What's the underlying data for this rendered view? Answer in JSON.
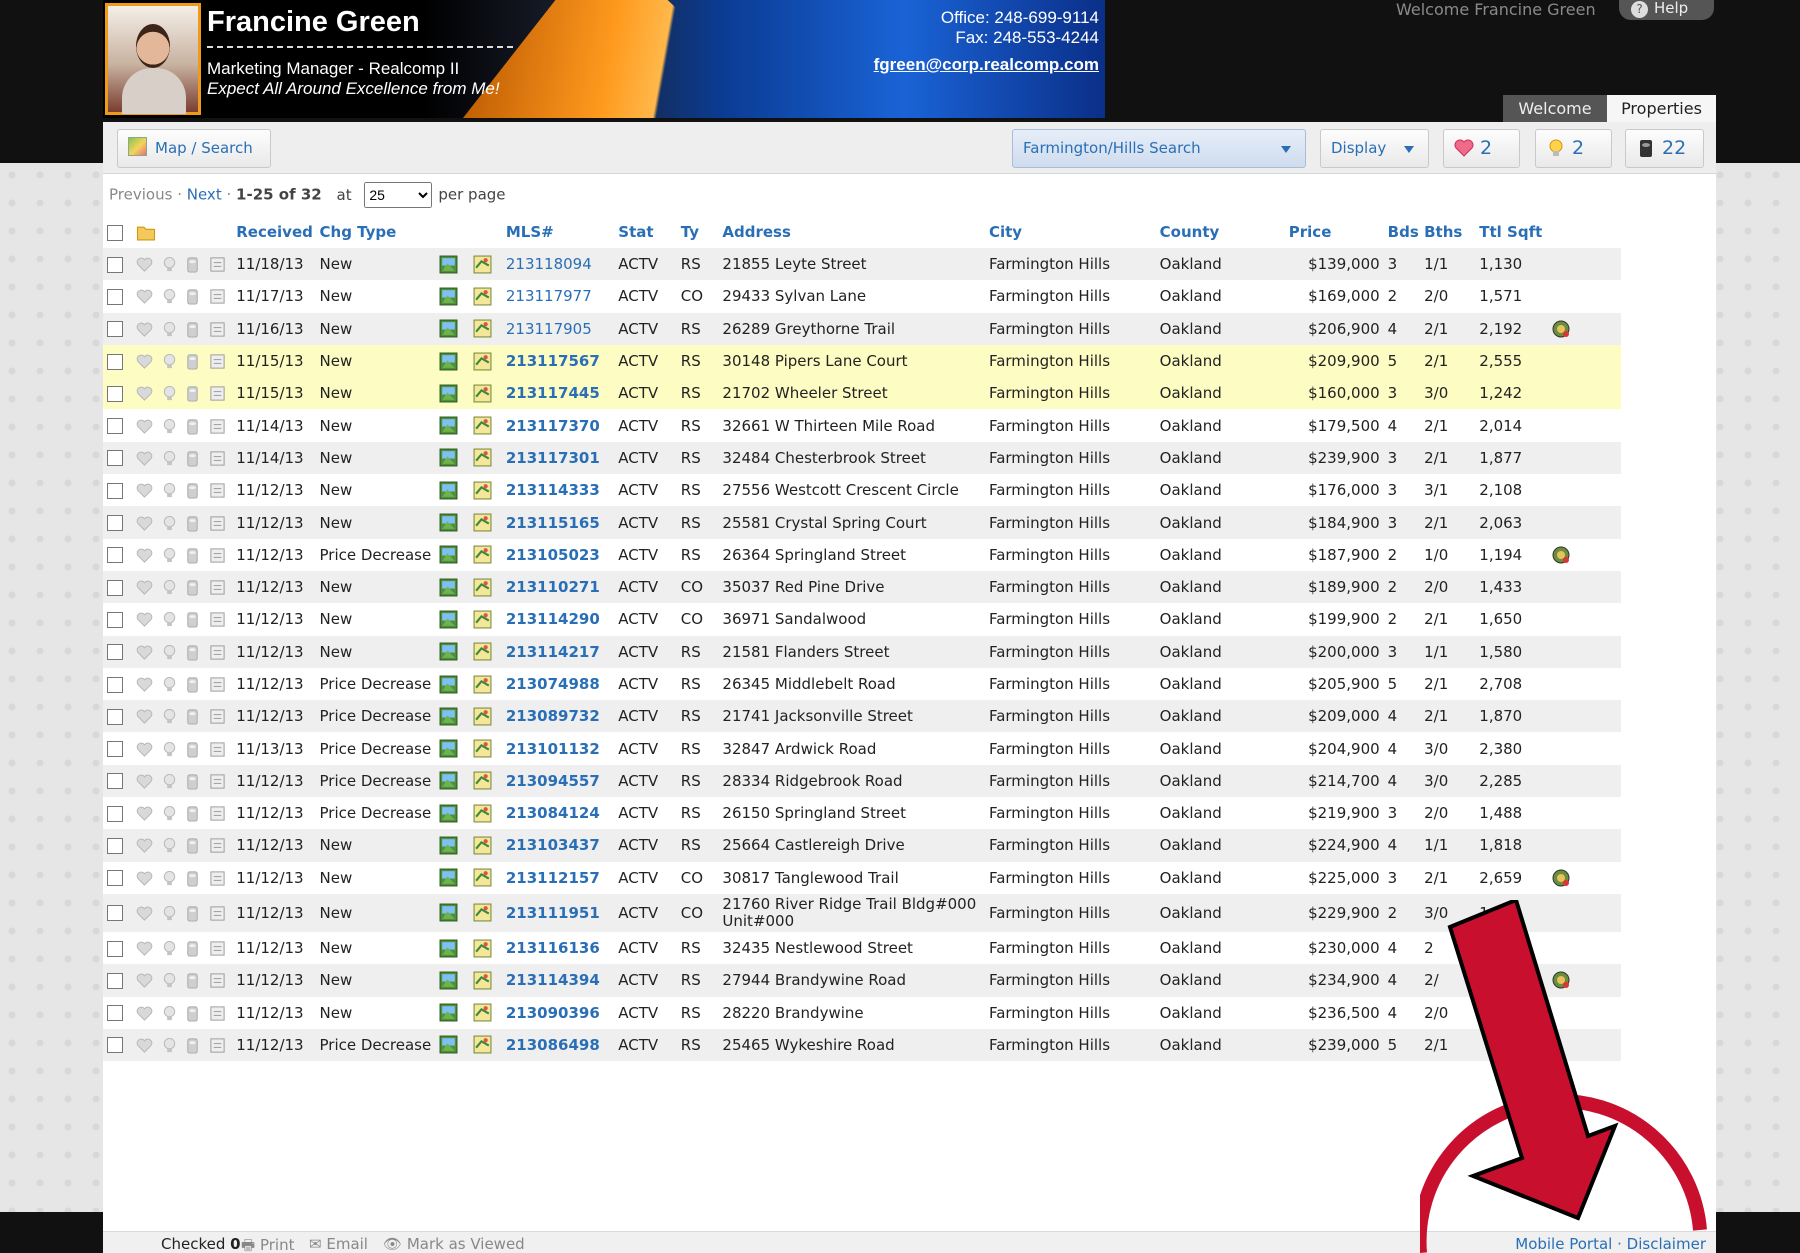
{
  "header": {
    "name": "Francine Green",
    "role": "Marketing Manager - Realcomp II",
    "tagline": "Expect All Around Excellence from Me!",
    "office": "Office: 248-699-9114",
    "fax": "Fax: 248-553-4244",
    "email": "fgreen@corp.realcomp.com",
    "welcome": "Welcome Francine Green",
    "help": "Help",
    "help_icon": "?"
  },
  "tabs": {
    "welcome": "Welcome",
    "properties": "Properties"
  },
  "toolbar": {
    "map_search": "Map / Search",
    "saved_search": "Farmington/Hills Search",
    "display": "Display",
    "favorites_count": "2",
    "possibilities_count": "2",
    "trash_count": "22"
  },
  "pager": {
    "previous": "Previous",
    "sep": "·",
    "next": "Next",
    "range": "1-25 of 32",
    "at": "at",
    "per_page_value": "25",
    "per_page_label": "per page"
  },
  "columns": {
    "received": "Received",
    "chg_type": "Chg Type",
    "mls": "MLS#",
    "stat": "Stat",
    "ty": "Ty",
    "address": "Address",
    "city": "City",
    "county": "County",
    "price": "Price",
    "bds": "Bds",
    "bths": "Bths",
    "sqft": "Ttl Sqft"
  },
  "rows": [
    {
      "date": "11/18/13",
      "chg": "New",
      "mls": "213118094",
      "stat": "ACTV",
      "ty": "RS",
      "address": "21855 Leyte Street",
      "city": "Farmington Hills",
      "county": "Oakland",
      "price": "$139,000",
      "bds": "3",
      "bths": "1/1",
      "sqft": "1,130"
    },
    {
      "date": "11/17/13",
      "chg": "New",
      "mls": "213117977",
      "stat": "ACTV",
      "ty": "CO",
      "address": "29433 Sylvan Lane",
      "city": "Farmington Hills",
      "county": "Oakland",
      "price": "$169,000",
      "bds": "2",
      "bths": "2/0",
      "sqft": "1,571"
    },
    {
      "date": "11/16/13",
      "chg": "New",
      "mls": "213117905",
      "stat": "ACTV",
      "ty": "RS",
      "address": "26289 Greythorne Trail",
      "city": "Farmington Hills",
      "county": "Oakland",
      "price": "$206,900",
      "bds": "4",
      "bths": "2/1",
      "sqft": "2,192"
    },
    {
      "date": "11/15/13",
      "chg": "New",
      "mls": "213117567",
      "stat": "ACTV",
      "ty": "RS",
      "address": "30148 Pipers Lane Court",
      "city": "Farmington Hills",
      "county": "Oakland",
      "price": "$209,900",
      "bds": "5",
      "bths": "2/1",
      "sqft": "2,555"
    },
    {
      "date": "11/15/13",
      "chg": "New",
      "mls": "213117445",
      "stat": "ACTV",
      "ty": "RS",
      "address": "21702 Wheeler Street",
      "city": "Farmington Hills",
      "county": "Oakland",
      "price": "$160,000",
      "bds": "3",
      "bths": "3/0",
      "sqft": "1,242"
    },
    {
      "date": "11/14/13",
      "chg": "New",
      "mls": "213117370",
      "stat": "ACTV",
      "ty": "RS",
      "address": "32661 W Thirteen Mile Road",
      "city": "Farmington Hills",
      "county": "Oakland",
      "price": "$179,500",
      "bds": "4",
      "bths": "2/1",
      "sqft": "2,014"
    },
    {
      "date": "11/14/13",
      "chg": "New",
      "mls": "213117301",
      "stat": "ACTV",
      "ty": "RS",
      "address": "32484 Chesterbrook Street",
      "city": "Farmington Hills",
      "county": "Oakland",
      "price": "$239,900",
      "bds": "3",
      "bths": "2/1",
      "sqft": "1,877"
    },
    {
      "date": "11/12/13",
      "chg": "New",
      "mls": "213114333",
      "stat": "ACTV",
      "ty": "RS",
      "address": "27556 Westcott Crescent Circle",
      "city": "Farmington Hills",
      "county": "Oakland",
      "price": "$176,000",
      "bds": "3",
      "bths": "3/1",
      "sqft": "2,108"
    },
    {
      "date": "11/12/13",
      "chg": "New",
      "mls": "213115165",
      "stat": "ACTV",
      "ty": "RS",
      "address": "25581 Crystal Spring Court",
      "city": "Farmington Hills",
      "county": "Oakland",
      "price": "$184,900",
      "bds": "3",
      "bths": "2/1",
      "sqft": "2,063"
    },
    {
      "date": "11/12/13",
      "chg": "Price Decrease",
      "mls": "213105023",
      "stat": "ACTV",
      "ty": "RS",
      "address": "26364 Springland Street",
      "city": "Farmington Hills",
      "county": "Oakland",
      "price": "$187,900",
      "bds": "2",
      "bths": "1/0",
      "sqft": "1,194"
    },
    {
      "date": "11/12/13",
      "chg": "New",
      "mls": "213110271",
      "stat": "ACTV",
      "ty": "CO",
      "address": "35037 Red Pine Drive",
      "city": "Farmington Hills",
      "county": "Oakland",
      "price": "$189,900",
      "bds": "2",
      "bths": "2/0",
      "sqft": "1,433"
    },
    {
      "date": "11/12/13",
      "chg": "New",
      "mls": "213114290",
      "stat": "ACTV",
      "ty": "CO",
      "address": "36971 Sandalwood",
      "city": "Farmington Hills",
      "county": "Oakland",
      "price": "$199,900",
      "bds": "2",
      "bths": "2/1",
      "sqft": "1,650"
    },
    {
      "date": "11/12/13",
      "chg": "New",
      "mls": "213114217",
      "stat": "ACTV",
      "ty": "RS",
      "address": "21581 Flanders Street",
      "city": "Farmington Hills",
      "county": "Oakland",
      "price": "$200,000",
      "bds": "3",
      "bths": "1/1",
      "sqft": "1,580"
    },
    {
      "date": "11/12/13",
      "chg": "Price Decrease",
      "mls": "213074988",
      "stat": "ACTV",
      "ty": "RS",
      "address": "26345 Middlebelt Road",
      "city": "Farmington Hills",
      "county": "Oakland",
      "price": "$205,900",
      "bds": "5",
      "bths": "2/1",
      "sqft": "2,708"
    },
    {
      "date": "11/12/13",
      "chg": "Price Decrease",
      "mls": "213089732",
      "stat": "ACTV",
      "ty": "RS",
      "address": "21741 Jacksonville Street",
      "city": "Farmington Hills",
      "county": "Oakland",
      "price": "$209,000",
      "bds": "4",
      "bths": "2/1",
      "sqft": "1,870"
    },
    {
      "date": "11/13/13",
      "chg": "Price Decrease",
      "mls": "213101132",
      "stat": "ACTV",
      "ty": "RS",
      "address": "32847 Ardwick Road",
      "city": "Farmington Hills",
      "county": "Oakland",
      "price": "$204,900",
      "bds": "4",
      "bths": "3/0",
      "sqft": "2,380"
    },
    {
      "date": "11/12/13",
      "chg": "Price Decrease",
      "mls": "213094557",
      "stat": "ACTV",
      "ty": "RS",
      "address": "28334 Ridgebrook Road",
      "city": "Farmington Hills",
      "county": "Oakland",
      "price": "$214,700",
      "bds": "4",
      "bths": "3/0",
      "sqft": "2,285"
    },
    {
      "date": "11/12/13",
      "chg": "Price Decrease",
      "mls": "213084124",
      "stat": "ACTV",
      "ty": "RS",
      "address": "26150 Springland Street",
      "city": "Farmington Hills",
      "county": "Oakland",
      "price": "$219,900",
      "bds": "3",
      "bths": "2/0",
      "sqft": "1,488"
    },
    {
      "date": "11/12/13",
      "chg": "New",
      "mls": "213103437",
      "stat": "ACTV",
      "ty": "RS",
      "address": "25664 Castlereigh Drive",
      "city": "Farmington Hills",
      "county": "Oakland",
      "price": "$224,900",
      "bds": "4",
      "bths": "1/1",
      "sqft": "1,818"
    },
    {
      "date": "11/12/13",
      "chg": "New",
      "mls": "213112157",
      "stat": "ACTV",
      "ty": "CO",
      "address": "30817 Tanglewood Trail",
      "city": "Farmington Hills",
      "county": "Oakland",
      "price": "$225,000",
      "bds": "3",
      "bths": "2/1",
      "sqft": "2,659"
    },
    {
      "date": "11/12/13",
      "chg": "New",
      "mls": "213111951",
      "stat": "ACTV",
      "ty": "CO",
      "address": "21760 River Ridge Trail Bldg#000 Unit#000",
      "city": "Farmington Hills",
      "county": "Oakland",
      "price": "$229,900",
      "bds": "2",
      "bths": "3/0",
      "sqft": "1,494"
    },
    {
      "date": "11/12/13",
      "chg": "New",
      "mls": "213116136",
      "stat": "ACTV",
      "ty": "RS",
      "address": "32435 Nestlewood Street",
      "city": "Farmington Hills",
      "county": "Oakland",
      "price": "$230,000",
      "bds": "4",
      "bths": "2",
      "sqft": "4"
    },
    {
      "date": "11/12/13",
      "chg": "New",
      "mls": "213114394",
      "stat": "ACTV",
      "ty": "RS",
      "address": "27944 Brandywine Road",
      "city": "Farmington Hills",
      "county": "Oakland",
      "price": "$234,900",
      "bds": "4",
      "bths": "2/",
      "sqft": "5"
    },
    {
      "date": "11/12/13",
      "chg": "New",
      "mls": "213090396",
      "stat": "ACTV",
      "ty": "RS",
      "address": "28220 Brandywine",
      "city": "Farmington Hills",
      "county": "Oakland",
      "price": "$236,500",
      "bds": "4",
      "bths": "2/0",
      "sqft": ""
    },
    {
      "date": "11/12/13",
      "chg": "Price Decrease",
      "mls": "213086498",
      "stat": "ACTV",
      "ty": "RS",
      "address": "25465 Wykeshire Road",
      "city": "Farmington Hills",
      "county": "Oakland",
      "price": "$239,000",
      "bds": "5",
      "bths": "2/1",
      "sqft": ""
    }
  ],
  "row_styles": [
    "odd",
    "even",
    "odd",
    "hl",
    "hl",
    "even",
    "odd",
    "even",
    "odd",
    "even",
    "odd",
    "even",
    "odd",
    "even",
    "odd",
    "even",
    "odd",
    "even",
    "odd",
    "even",
    "odd",
    "even",
    "odd",
    "even",
    "odd"
  ],
  "bold_mls_rows": [
    3,
    4,
    5,
    6,
    7,
    8,
    9,
    10,
    11,
    12,
    13,
    14,
    15,
    16,
    17,
    18,
    19,
    20,
    21,
    22,
    23,
    24
  ],
  "badge_rows": [
    2,
    9,
    19,
    22
  ],
  "footer": {
    "checked_label": "Checked",
    "checked_count": "0",
    "print": "Print",
    "email": "Email",
    "mark_viewed": "Mark as Viewed",
    "mobile_portal": "Mobile Portal",
    "sep": "·",
    "disclaimer": "Disclaimer"
  },
  "colors": {
    "link": "#2a6fb6",
    "highlight_row": "#fdfcc2",
    "annotation_arrow": "#c8102e"
  }
}
